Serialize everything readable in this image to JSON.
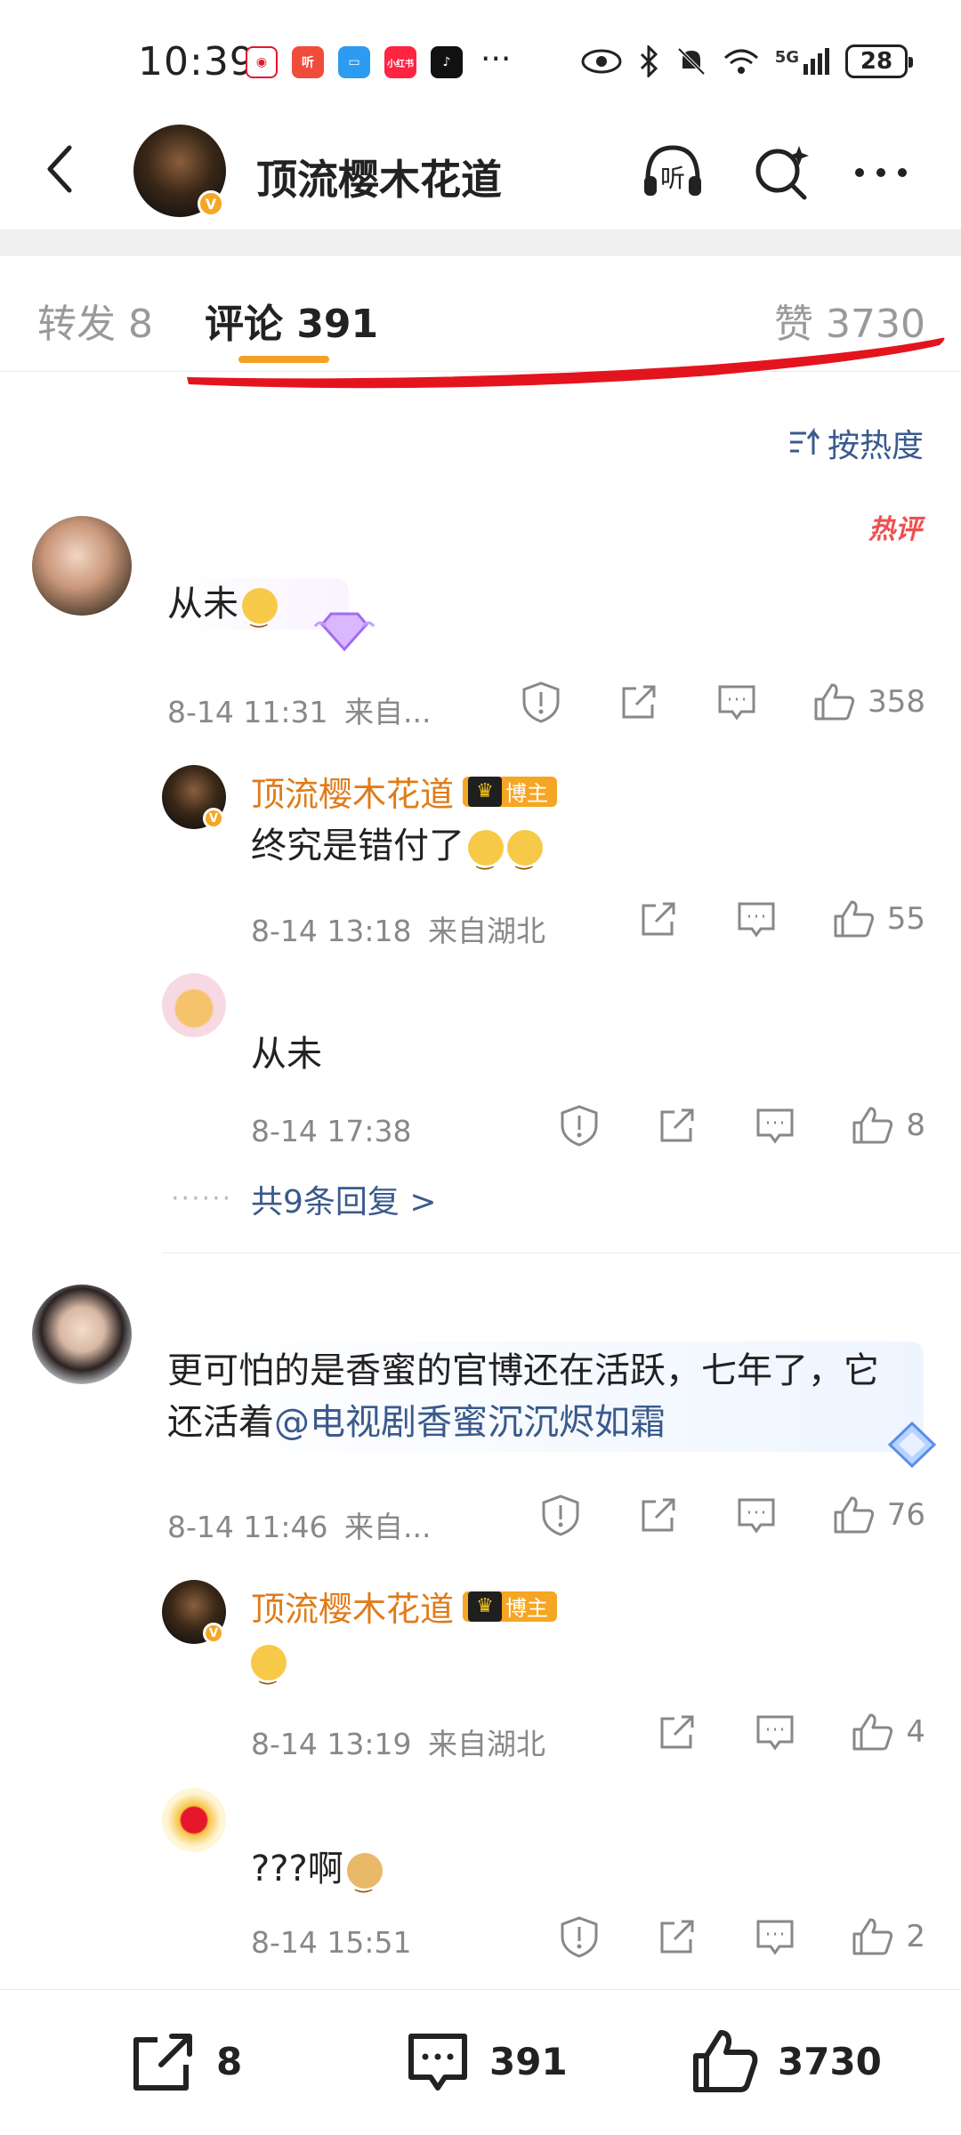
{
  "status_bar": {
    "time": "10:39",
    "network": "5G",
    "battery": "28"
  },
  "header": {
    "title": "顶流樱木花道"
  },
  "tabs": {
    "repost": "转发 8",
    "comments": "评论 391",
    "likes": "赞 3730"
  },
  "sort": {
    "label": "按热度"
  },
  "hot_tag": "热评",
  "comments": [
    {
      "text": "从未",
      "time": "8-14 11:31",
      "source": "来自...",
      "likes": "358",
      "replies": [
        {
          "author": "顶流樱木花道",
          "badge": "博主",
          "text": "终究是错付了",
          "time": "8-14 13:18",
          "source": "来自湖北",
          "likes": "55"
        },
        {
          "text": "从未",
          "time": "8-14 17:38",
          "likes": "8"
        }
      ],
      "more_replies": "共9条回复 >"
    },
    {
      "text_main": "更可怕的是香蜜的官博还在活跃，七年了，它还活着",
      "mention": "@电视剧香蜜沉沉烬如霜",
      "time": "8-14 11:46",
      "source": "来自...",
      "likes": "76",
      "replies": [
        {
          "author": "顶流樱木花道",
          "badge": "博主",
          "time": "8-14 13:19",
          "source": "来自湖北",
          "likes": "4"
        },
        {
          "text": "???啊",
          "time": "8-14 15:51",
          "likes": "2"
        }
      ]
    }
  ],
  "bottom_bar": {
    "repost_count": "8",
    "comment_count": "391",
    "like_count": "3730"
  },
  "colors": {
    "accent_orange": "#f4a028",
    "link_blue": "#3a5a8c",
    "author_orange": "#e07b1a",
    "annotation_red": "#e4141e"
  }
}
